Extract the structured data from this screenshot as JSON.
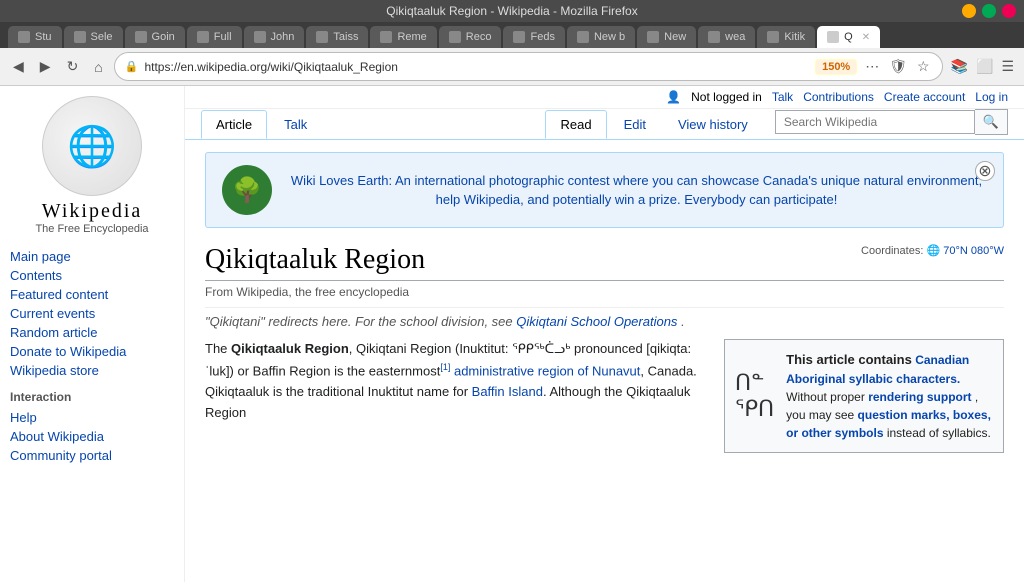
{
  "browser": {
    "title": "Qikiqtaaluk Region - Wikipedia - Mozilla Firefox",
    "url": "https://en.wikipedia.org/wiki/Qikiqtaaluk_Region",
    "zoom": "150%",
    "tabs": [
      {
        "label": "Stu",
        "active": false
      },
      {
        "label": "Sele",
        "active": false
      },
      {
        "label": "Goin",
        "active": false
      },
      {
        "label": "Full",
        "active": false
      },
      {
        "label": "John",
        "active": false
      },
      {
        "label": "Taiss",
        "active": false
      },
      {
        "label": "Reme",
        "active": false
      },
      {
        "label": "Reco",
        "active": false
      },
      {
        "label": "Feds",
        "active": false
      },
      {
        "label": "New b",
        "active": false
      },
      {
        "label": "New",
        "active": false
      },
      {
        "label": "wea",
        "active": false
      },
      {
        "label": "Kitik",
        "active": false
      },
      {
        "label": "Q",
        "active": true
      }
    ]
  },
  "userbar": {
    "not_logged_in": "Not logged in",
    "talk": "Talk",
    "contributions": "Contributions",
    "create_account": "Create account",
    "log_in": "Log in"
  },
  "tabs": {
    "article": "Article",
    "talk": "Talk",
    "read": "Read",
    "edit": "Edit",
    "view_history": "View history"
  },
  "search": {
    "placeholder": "Search Wikipedia"
  },
  "sidebar": {
    "logo_alt": "Wikipedia globe",
    "site_name": "Wikipedia",
    "tagline": "The Free Encyclopedia",
    "nav": [
      {
        "label": "Main page",
        "id": "main-page"
      },
      {
        "label": "Contents",
        "id": "contents"
      },
      {
        "label": "Featured content",
        "id": "featured-content"
      },
      {
        "label": "Current events",
        "id": "current-events"
      },
      {
        "label": "Random article",
        "id": "random-article"
      },
      {
        "label": "Donate to Wikipedia",
        "id": "donate"
      },
      {
        "label": "Wikipedia store",
        "id": "wiki-store"
      }
    ],
    "interaction_title": "Interaction",
    "interaction": [
      {
        "label": "Help",
        "id": "help"
      },
      {
        "label": "About Wikipedia",
        "id": "about"
      },
      {
        "label": "Community portal",
        "id": "community-portal"
      }
    ]
  },
  "banner": {
    "text": "Wiki Loves Earth: An international photographic contest where you can showcase Canada's unique natural environment, help Wikipedia, and potentially win a prize. Everybody can participate!",
    "icon": "🌳"
  },
  "article": {
    "title": "Qikiqtaaluk Region",
    "subtitle": "From Wikipedia, the free encyclopedia",
    "coordinates_label": "Coordinates:",
    "coordinates_value": "70°N 080°W",
    "redirect_text": "\"Qikiqtani\" redirects here. For the school division, see",
    "redirect_link": "Qikiqtani School Operations",
    "redirect_end": ".",
    "para1_start": "The ",
    "para1_bold": "Qikiqtaaluk Region",
    "para1_content": ", Qikiqtani Region (Inuktitut: ᕿᑭᖅᑖᓗᒃ pronounced [qikiqta:ˈluk]) or Baffin Region is the easternmost",
    "para1_sup": "[1]",
    "para1_link1": "administrative region of Nunavut",
    "para1_mid": ", Canada. Qikiqtaaluk is the traditional Inuktitut name for",
    "para1_link2": "Baffin Island",
    "para1_end": ". Although the Qikiqtaaluk Region",
    "sidebox_title": "This article contains",
    "sidebox_link": "Canadian Aboriginal syllabic characters.",
    "sidebox_text": " Without proper",
    "sidebox_link2": "rendering support",
    "sidebox_text2": ", you may see",
    "sidebox_link3": "question marks, boxes, or other symbols",
    "sidebox_text3": " instead of syllabics.",
    "syllabics": "ᑎ·ᓐ\nᕿᑎ"
  }
}
